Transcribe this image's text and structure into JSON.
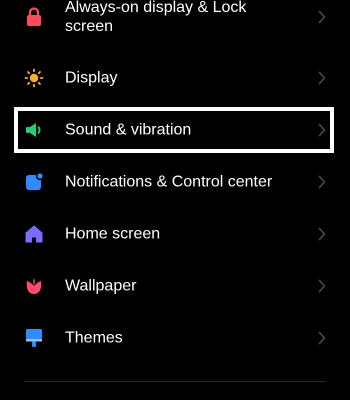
{
  "settings": {
    "items": [
      {
        "label": "Always-on display & Lock screen",
        "icon": "lock-icon",
        "icon_color": "#ff4b5c"
      },
      {
        "label": "Display",
        "icon": "sun-icon",
        "icon_color": "#ffb020"
      },
      {
        "label": "Sound & vibration",
        "icon": "speaker-icon",
        "icon_color": "#2ecc71"
      },
      {
        "label": "Notifications & Control center",
        "icon": "notification-icon",
        "icon_color": "#2f8bff"
      },
      {
        "label": "Home screen",
        "icon": "home-icon",
        "icon_color": "#7a6cff"
      },
      {
        "label": "Wallpaper",
        "icon": "flower-icon",
        "icon_color": "#ff4b6e"
      },
      {
        "label": "Themes",
        "icon": "brush-icon",
        "icon_color": "#2f8bff"
      }
    ],
    "highlighted_item": "Sound & vibration"
  },
  "colors": {
    "background": "#000000",
    "text": "#ffffff",
    "chevron": "#4a4a4a",
    "highlight_border": "#ffffff"
  }
}
